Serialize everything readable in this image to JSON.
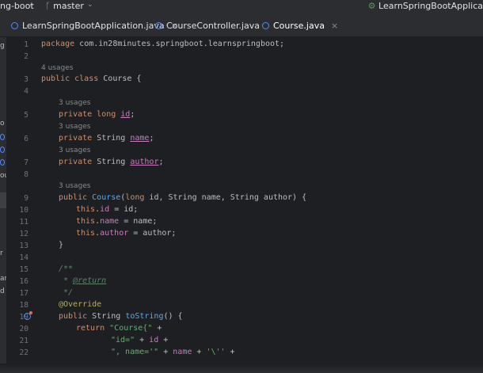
{
  "topbar": {
    "project_fragment": "ng-boot",
    "branch": "master",
    "run_config": "LearnSpringBootApplica"
  },
  "tabs": [
    {
      "label": "LearnSpringBootApplication.java",
      "close": "×"
    },
    {
      "label": "CourseController.java",
      "close": "×"
    },
    {
      "label": "Course.java",
      "close": "×"
    }
  ],
  "left_strip_fragments": [
    "g",
    "o",
    "ou",
    "r",
    "ar",
    "d"
  ],
  "editor": {
    "line_numbers": [
      "1",
      "2",
      "3",
      "4",
      "5",
      "6",
      "7",
      "8",
      "9",
      "10",
      "11",
      "12",
      "13",
      "14",
      "15",
      "16",
      "17",
      "18",
      "19",
      "20",
      "21",
      "22"
    ],
    "usages": {
      "class": "4 usages",
      "id": "3 usages",
      "name": "3 usages",
      "author": "3 usages",
      "ctor": "3 usages"
    },
    "code": {
      "l1": "package com.in28minutes.springboot.learnspringboot;",
      "l3_kw": "public class",
      "l3_name": "Course",
      "l3_brace": " {",
      "l5_kw": "private long",
      "l5_fld": "id",
      "l6_kw": "private",
      "l6_type": "String",
      "l6_fld": "name",
      "l7_kw": "private",
      "l7_type": "String",
      "l7_fld": "author",
      "semi": ";",
      "l9_kw": "public",
      "l9_name": "Course",
      "l9_rest_a": "(",
      "l9_long": "long",
      "l9_rest_b": " id, String name, String author) {",
      "l10_this": "this",
      "l10_fld": "id",
      "l10_rest": " = id;",
      "l11_this": "this",
      "l11_fld": "name",
      "l11_rest": " = name;",
      "l12_this": "this",
      "l12_fld": "author",
      "l12_rest": " = author;",
      "l13": "}",
      "l15": "/**",
      "l16_star": "*",
      "l16_tag": "@return",
      "l17": "*/",
      "l18": "@Override",
      "l19_kw": "public",
      "l19_type": "String",
      "l19_name": "toString",
      "l19_rest": "() {",
      "l20_kw": "return",
      "l20_str": "\"Course{\"",
      "l20_rest": " +",
      "l21_str": "\"id=\"",
      "l21_mid": " + ",
      "l21_fld": "id",
      "l21_rest": " +",
      "l22_str1": "\", name='\"",
      "l22_mid": " + ",
      "l22_fld": "name",
      "l22_plus": " + ",
      "l22_str2": "'\\''",
      "l22_rest": " +"
    }
  }
}
